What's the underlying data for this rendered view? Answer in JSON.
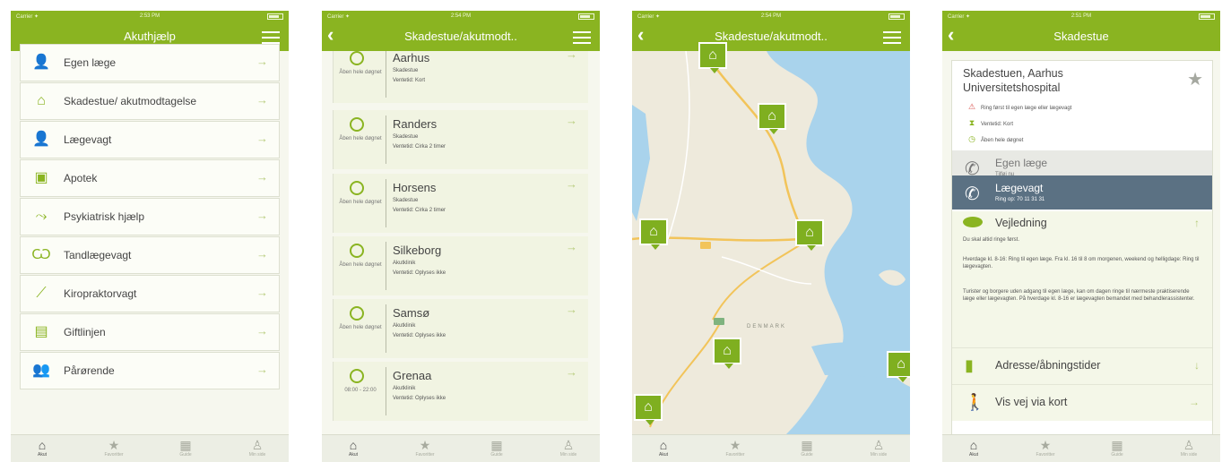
{
  "status": {
    "carrier": "Carrier ✦",
    "times": [
      "2:53 PM",
      "2:54 PM",
      "2:54 PM",
      "2:51 PM"
    ]
  },
  "screen1": {
    "title": "Akuthjælp",
    "items": [
      {
        "label": "Egen læge",
        "icon": "doctor-icon"
      },
      {
        "label": "Skadestue/ akutmodtagelse",
        "icon": "house-icon"
      },
      {
        "label": "Lægevagt",
        "icon": "doctor-icon"
      },
      {
        "label": "Apotek",
        "icon": "medicine-icon"
      },
      {
        "label": "Psykiatrisk hjælp",
        "icon": "psychiatric-icon"
      },
      {
        "label": "Tandlægevagt",
        "icon": "tooth-icon"
      },
      {
        "label": "Kiropraktorvagt",
        "icon": "chiropractor-icon"
      },
      {
        "label": "Giftlinjen",
        "icon": "poison-icon"
      },
      {
        "label": "Pårørende",
        "icon": "relatives-icon"
      }
    ]
  },
  "screen2": {
    "title": "Skadestue/akutmodt..",
    "rows": [
      {
        "city": "Aarhus",
        "type": "Skadestue",
        "wait": "Ventetid: Kort",
        "hours": "Åben hele døgnet"
      },
      {
        "city": "Randers",
        "type": "Skadestue",
        "wait": "Ventetid: Cirka 2 timer",
        "hours": "Åben hele døgnet"
      },
      {
        "city": "Horsens",
        "type": "Skadestue",
        "wait": "Ventetid: Cirka 2 timer",
        "hours": "Åben hele døgnet"
      },
      {
        "city": "Silkeborg",
        "type": "Akutklinik",
        "wait": "Ventetid: Oplyses ikke",
        "hours": "Åben hele døgnet"
      },
      {
        "city": "Samsø",
        "type": "Akutklinik",
        "wait": "Ventetid: Oplyses ikke",
        "hours": "Åben hele døgnet"
      },
      {
        "city": "Grenaa",
        "type": "Akutklinik",
        "wait": "Ventetid: Oplyses ikke",
        "hours": "08:00 - 22:00"
      }
    ]
  },
  "screen3": {
    "title": "Skadestue/akutmodt..",
    "map_label": "DENMARK"
  },
  "screen4": {
    "title": "Skadestue",
    "hospital": "Skadestuen, Aarhus Universitetshospital",
    "info": [
      {
        "sym": "⚠",
        "text": "Ring først til egen læge eller lægevagt"
      },
      {
        "sym": "⧗",
        "text": "Ventetid: Kort"
      },
      {
        "sym": "◷",
        "text": "Åben hele døgnet"
      }
    ],
    "call1": {
      "name": "Egen læge",
      "sub": "Tilføj nu"
    },
    "call2": {
      "name": "Lægevagt",
      "sub": "Ring op: 70 11 31 31"
    },
    "guidance": {
      "title": "Vejledning",
      "p1": "Du skal altid ringe først.",
      "p2": "Hverdage kl. 8-16: Ring til egen læge. Fra kl. 16 til 8 om morgenen, weekend og helligdage: Ring til lægevagten.",
      "p3": "Turister og borgere uden adgang til egen læge, kan om dagen ringe til nærmeste praktiserende læge eller lægevagten. På hverdage kl. 8-16 er lægevagten bemandet med behandlerassistenter."
    },
    "address": "Adresse/åbningstider",
    "route": "Vis vej via kort"
  },
  "tabbar": {
    "labels": [
      "Akut",
      "Favoritter",
      "Guide",
      "Min side"
    ]
  }
}
